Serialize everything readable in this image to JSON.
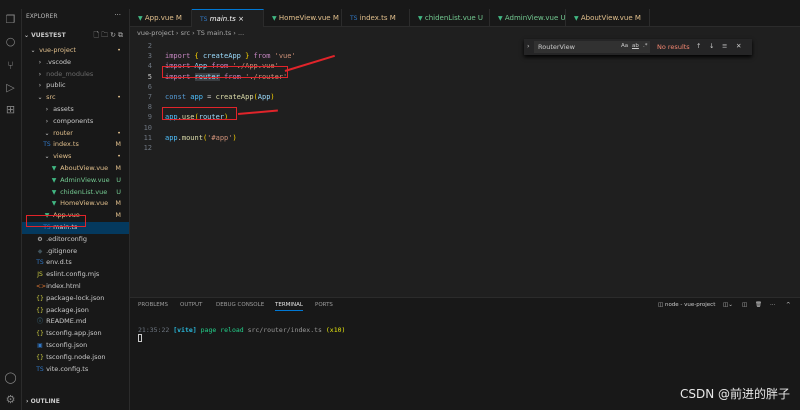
{
  "explorer": {
    "title": "EXPLORER",
    "root": "VUESTEST",
    "outline": "OUTLINE"
  },
  "tree": [
    {
      "label": "vue-project",
      "indent": 1,
      "icon": "chevron-down",
      "status": "•",
      "cls": "mod"
    },
    {
      "label": ".vscode",
      "indent": 2,
      "icon": "chevron-right",
      "status": "",
      "cls": ""
    },
    {
      "label": "node_modules",
      "indent": 2,
      "icon": "chevron-right",
      "status": "",
      "cls": "dim"
    },
    {
      "label": "public",
      "indent": 2,
      "icon": "chevron-right",
      "status": "",
      "cls": ""
    },
    {
      "label": "src",
      "indent": 2,
      "icon": "chevron-down",
      "status": "•",
      "cls": "mod"
    },
    {
      "label": "assets",
      "indent": 3,
      "icon": "chevron-right",
      "status": "",
      "cls": ""
    },
    {
      "label": "components",
      "indent": 3,
      "icon": "chevron-right",
      "status": "",
      "cls": ""
    },
    {
      "label": "router",
      "indent": 3,
      "icon": "chevron-down",
      "status": "•",
      "cls": "mod"
    },
    {
      "label": "index.ts",
      "indent": 3,
      "icon": "ts",
      "status": "M",
      "cls": "mod"
    },
    {
      "label": "views",
      "indent": 3,
      "icon": "chevron-down",
      "status": "•",
      "cls": "mod"
    },
    {
      "label": "AboutView.vue",
      "indent": 4,
      "icon": "vue",
      "status": "M",
      "cls": "mod"
    },
    {
      "label": "AdminView.vue",
      "indent": 4,
      "icon": "vue",
      "status": "U",
      "cls": "unt"
    },
    {
      "label": "chidenList.vue",
      "indent": 4,
      "icon": "vue",
      "status": "U",
      "cls": "unt"
    },
    {
      "label": "HomeView.vue",
      "indent": 4,
      "icon": "vue",
      "status": "M",
      "cls": "mod"
    },
    {
      "label": "App.vue",
      "indent": 3,
      "icon": "vue",
      "status": "M",
      "cls": "mod"
    },
    {
      "label": "main.ts",
      "indent": 3,
      "icon": "ts",
      "status": "",
      "cls": "sel"
    },
    {
      "label": ".editorconfig",
      "indent": 2,
      "icon": "gear",
      "status": "",
      "cls": ""
    },
    {
      "label": ".gitignore",
      "indent": 2,
      "icon": "git",
      "status": "",
      "cls": ""
    },
    {
      "label": "env.d.ts",
      "indent": 2,
      "icon": "ts",
      "status": "",
      "cls": ""
    },
    {
      "label": "eslint.config.mjs",
      "indent": 2,
      "icon": "js",
      "status": "",
      "cls": ""
    },
    {
      "label": "index.html",
      "indent": 2,
      "icon": "html",
      "status": "",
      "cls": ""
    },
    {
      "label": "package-lock.json",
      "indent": 2,
      "icon": "json",
      "status": "",
      "cls": ""
    },
    {
      "label": "package.json",
      "indent": 2,
      "icon": "json",
      "status": "",
      "cls": ""
    },
    {
      "label": "README.md",
      "indent": 2,
      "icon": "info",
      "status": "",
      "cls": ""
    },
    {
      "label": "tsconfig.app.json",
      "indent": 2,
      "icon": "json",
      "status": "",
      "cls": ""
    },
    {
      "label": "tsconfig.json",
      "indent": 2,
      "icon": "tsconfig",
      "status": "",
      "cls": ""
    },
    {
      "label": "tsconfig.node.json",
      "indent": 2,
      "icon": "json",
      "status": "",
      "cls": ""
    },
    {
      "label": "vite.config.ts",
      "indent": 2,
      "icon": "ts",
      "status": "",
      "cls": ""
    }
  ],
  "tabs": [
    {
      "label": "App.vue",
      "status": "M",
      "icon": "vue"
    },
    {
      "label": "main.ts",
      "status": "×",
      "icon": "ts",
      "active": true
    },
    {
      "label": "HomeView.vue",
      "status": "M",
      "icon": "vue"
    },
    {
      "label": "index.ts",
      "status": "M",
      "icon": "ts"
    },
    {
      "label": "chidenList.vue",
      "status": "U",
      "icon": "vue"
    },
    {
      "label": "AdminView.vue",
      "status": "U",
      "icon": "vue"
    },
    {
      "label": "AboutView.vue",
      "status": "M",
      "icon": "vue"
    }
  ],
  "breadcrumb": "vue-project › src › TS main.ts › ...",
  "code": [
    {
      "n": "2",
      "html": ""
    },
    {
      "n": "3",
      "html": "<span class='kw'>import</span> <span class='br'>{</span> <span class='var'>createApp</span> <span class='br'>}</span> <span class='kw'>from</span> <span class='str'>'vue'</span>"
    },
    {
      "n": "4",
      "html": "<span class='kw'>import</span> <span class='var'>App</span> <span class='kw'>from</span> <span class='str'>'./App.vue'</span>"
    },
    {
      "n": "5",
      "html": "<span class='kw'>import</span> <span class='var' style='background:#3a3d41'>router</span> <span class='kw'>from</span> <span class='str'>'./router'</span>"
    },
    {
      "n": "6",
      "html": ""
    },
    {
      "n": "7",
      "html": "<span class='cst'>const</span> <span class='id'>app</span> = <span class='fn'>createApp</span><span class='br'>(</span><span class='var'>App</span><span class='br'>)</span>"
    },
    {
      "n": "8",
      "html": ""
    },
    {
      "n": "9",
      "html": "<span class='id'>app</span>.<span class='fn'>use</span><span class='br'>(</span><span class='var'>router</span><span class='br'>)</span>"
    },
    {
      "n": "10",
      "html": ""
    },
    {
      "n": "11",
      "html": "<span class='id'>app</span>.<span class='fn'>mount</span><span class='br'>(</span><span class='str'>'#app'</span><span class='br'>)</span>"
    },
    {
      "n": "12",
      "html": ""
    }
  ],
  "find": {
    "value": "RouterView",
    "case": "Aa",
    "word": "ab",
    "regex": ".*",
    "result": "No results"
  },
  "panel": {
    "tabs": [
      "PROBLEMS",
      "OUTPUT",
      "DEBUG CONSOLE",
      "TERMINAL",
      "PORTS"
    ],
    "terminal_name": "node - vue-project",
    "line": {
      "time": "21:35:22",
      "tag": "[vite]",
      "msg": "page reload",
      "path": "src/router/index.ts",
      "count": "(x10)"
    }
  },
  "watermark": "CSDN @前进的胖子"
}
